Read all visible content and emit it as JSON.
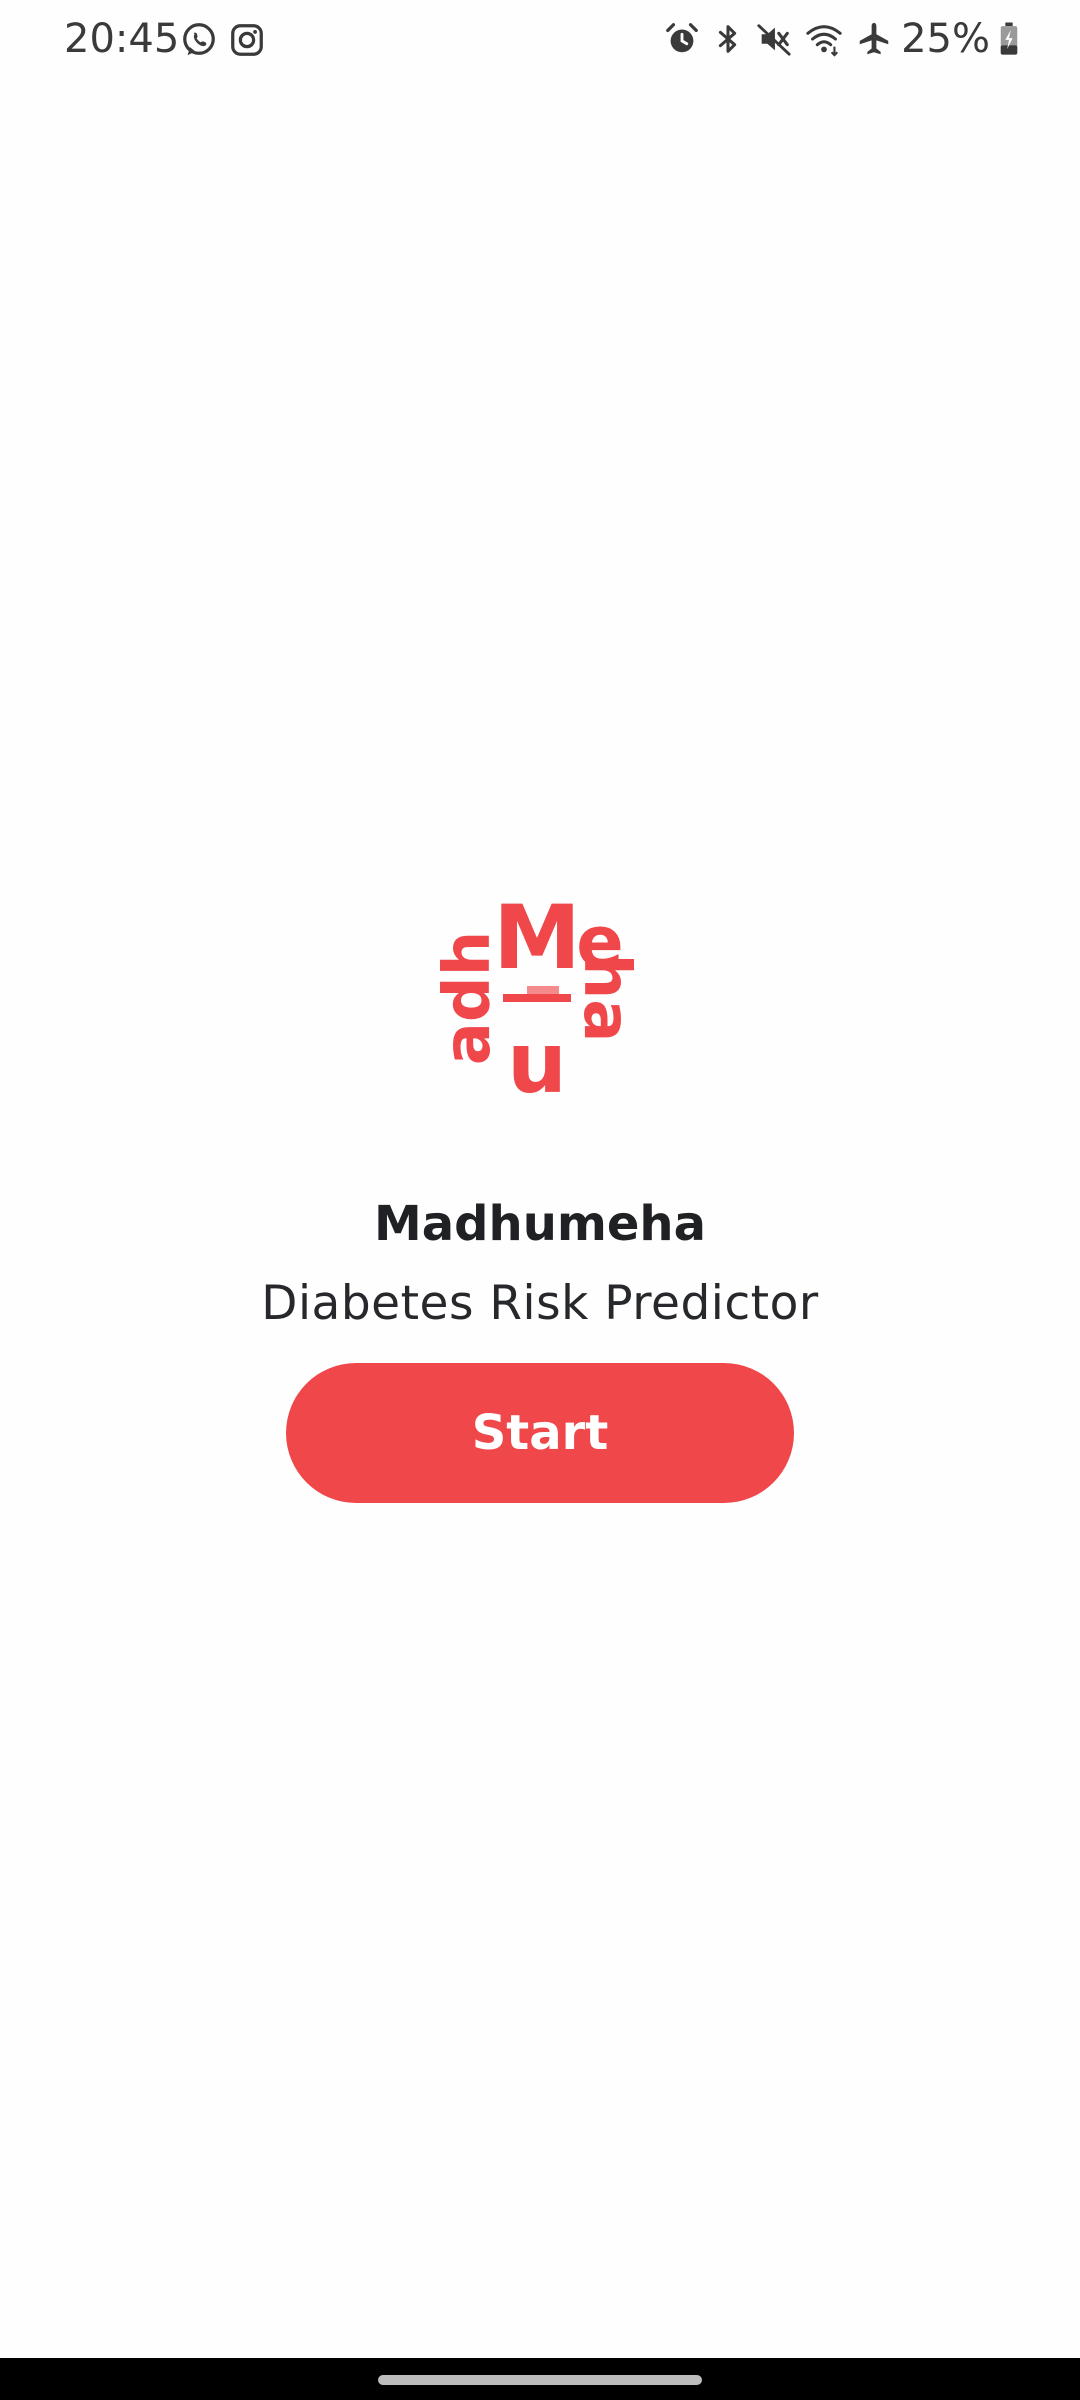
{
  "status_bar": {
    "time": "20:45",
    "left_icons": [
      "whatsapp-icon",
      "instagram-icon"
    ],
    "right_icons": [
      "alarm-icon",
      "bluetooth-icon",
      "mute-icon",
      "wifi-icon",
      "airplane-icon"
    ],
    "battery_percent": "25%",
    "battery_icon": "battery-charging-icon"
  },
  "app": {
    "logo_name": "madhumeha-logo",
    "title": "Madhumeha",
    "subtitle": "Diabetes Risk Predictor",
    "start_label": "Start"
  },
  "colors": {
    "accent": "#f0474b",
    "text_primary": "#1f2124",
    "background": "#fefefe",
    "nav_bar": "#000000"
  }
}
